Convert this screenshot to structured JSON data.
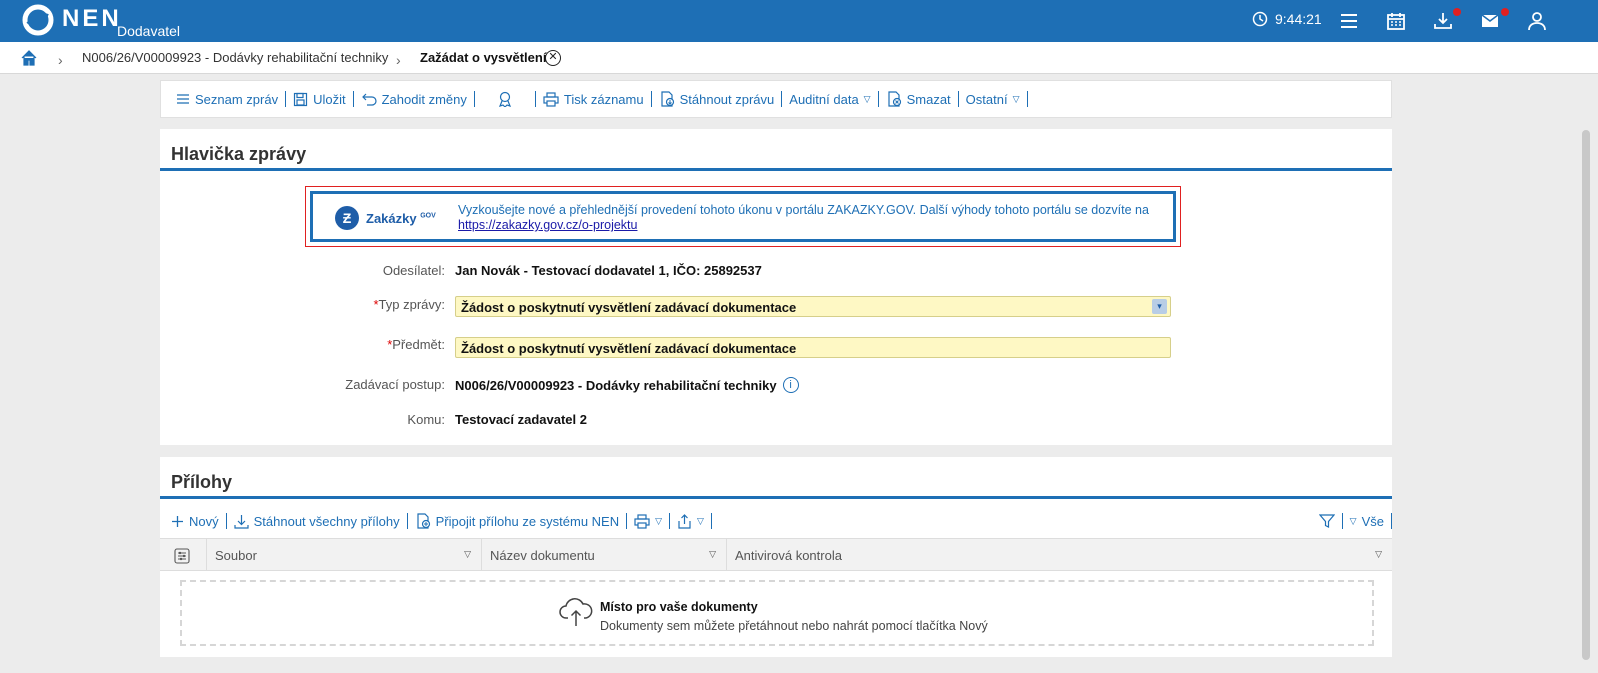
{
  "header": {
    "logo_text": "NEN",
    "logo_sub": "Dodavatel",
    "time": "9:44:21"
  },
  "breadcrumb": {
    "item1": "N006/26/V00009923 - Dodávky rehabilitační techniky",
    "item2": "Zažádat o vysvětlení"
  },
  "toolbar": {
    "list": "Seznam zpráv",
    "save": "Uložit",
    "discard": "Zahodit změny",
    "print": "Tisk záznamu",
    "download": "Stáhnout zprávu",
    "audit": "Auditní data",
    "delete": "Smazat",
    "other": "Ostatní"
  },
  "message_header": {
    "title": "Hlavička zprávy",
    "banner": {
      "brand": "Zakázky",
      "brand_sup": "GOV",
      "text": "Vyzkoušejte nové a přehlednější provedení tohoto úkonu v portálu ZAKAZKY.GOV. Další výhody tohoto portálu se dozvíte na",
      "link": "https://zakazky.gov.cz/o-projektu"
    },
    "sender_label": "Odesílatel:",
    "sender_value": "Jan Novák - Testovací dodavatel 1, IČO: 25892537",
    "type_label": "Typ zprávy:",
    "type_value": "Žádost o poskytnutí vysvětlení zadávací dokumentace",
    "subject_label": "Předmět:",
    "subject_value": "Žádost o poskytnutí vysvětlení zadávací dokumentace",
    "procedure_label": "Zadávací postup:",
    "procedure_value": "N006/26/V00009923 - Dodávky rehabilitační techniky",
    "to_label": "Komu:",
    "to_value": "Testovací zadavatel 2"
  },
  "attachments": {
    "title": "Přílohy",
    "new": "Nový",
    "download_all": "Stáhnout všechny přílohy",
    "attach_nen": "Připojit přílohu ze systému NEN",
    "filter_all": "Vše",
    "columns": [
      "Soubor",
      "Název dokumentu",
      "Antivirová kontrola"
    ],
    "drop_title": "Místo pro vaše dokumenty",
    "drop_sub": "Dokumenty sem můžete přetáhnout nebo nahrát pomocí tlačítka Nový"
  },
  "colors": {
    "primary": "#1e6fb5",
    "required": "#dd0000",
    "input_bg": "#fef8c4",
    "notification": "#e02020"
  }
}
